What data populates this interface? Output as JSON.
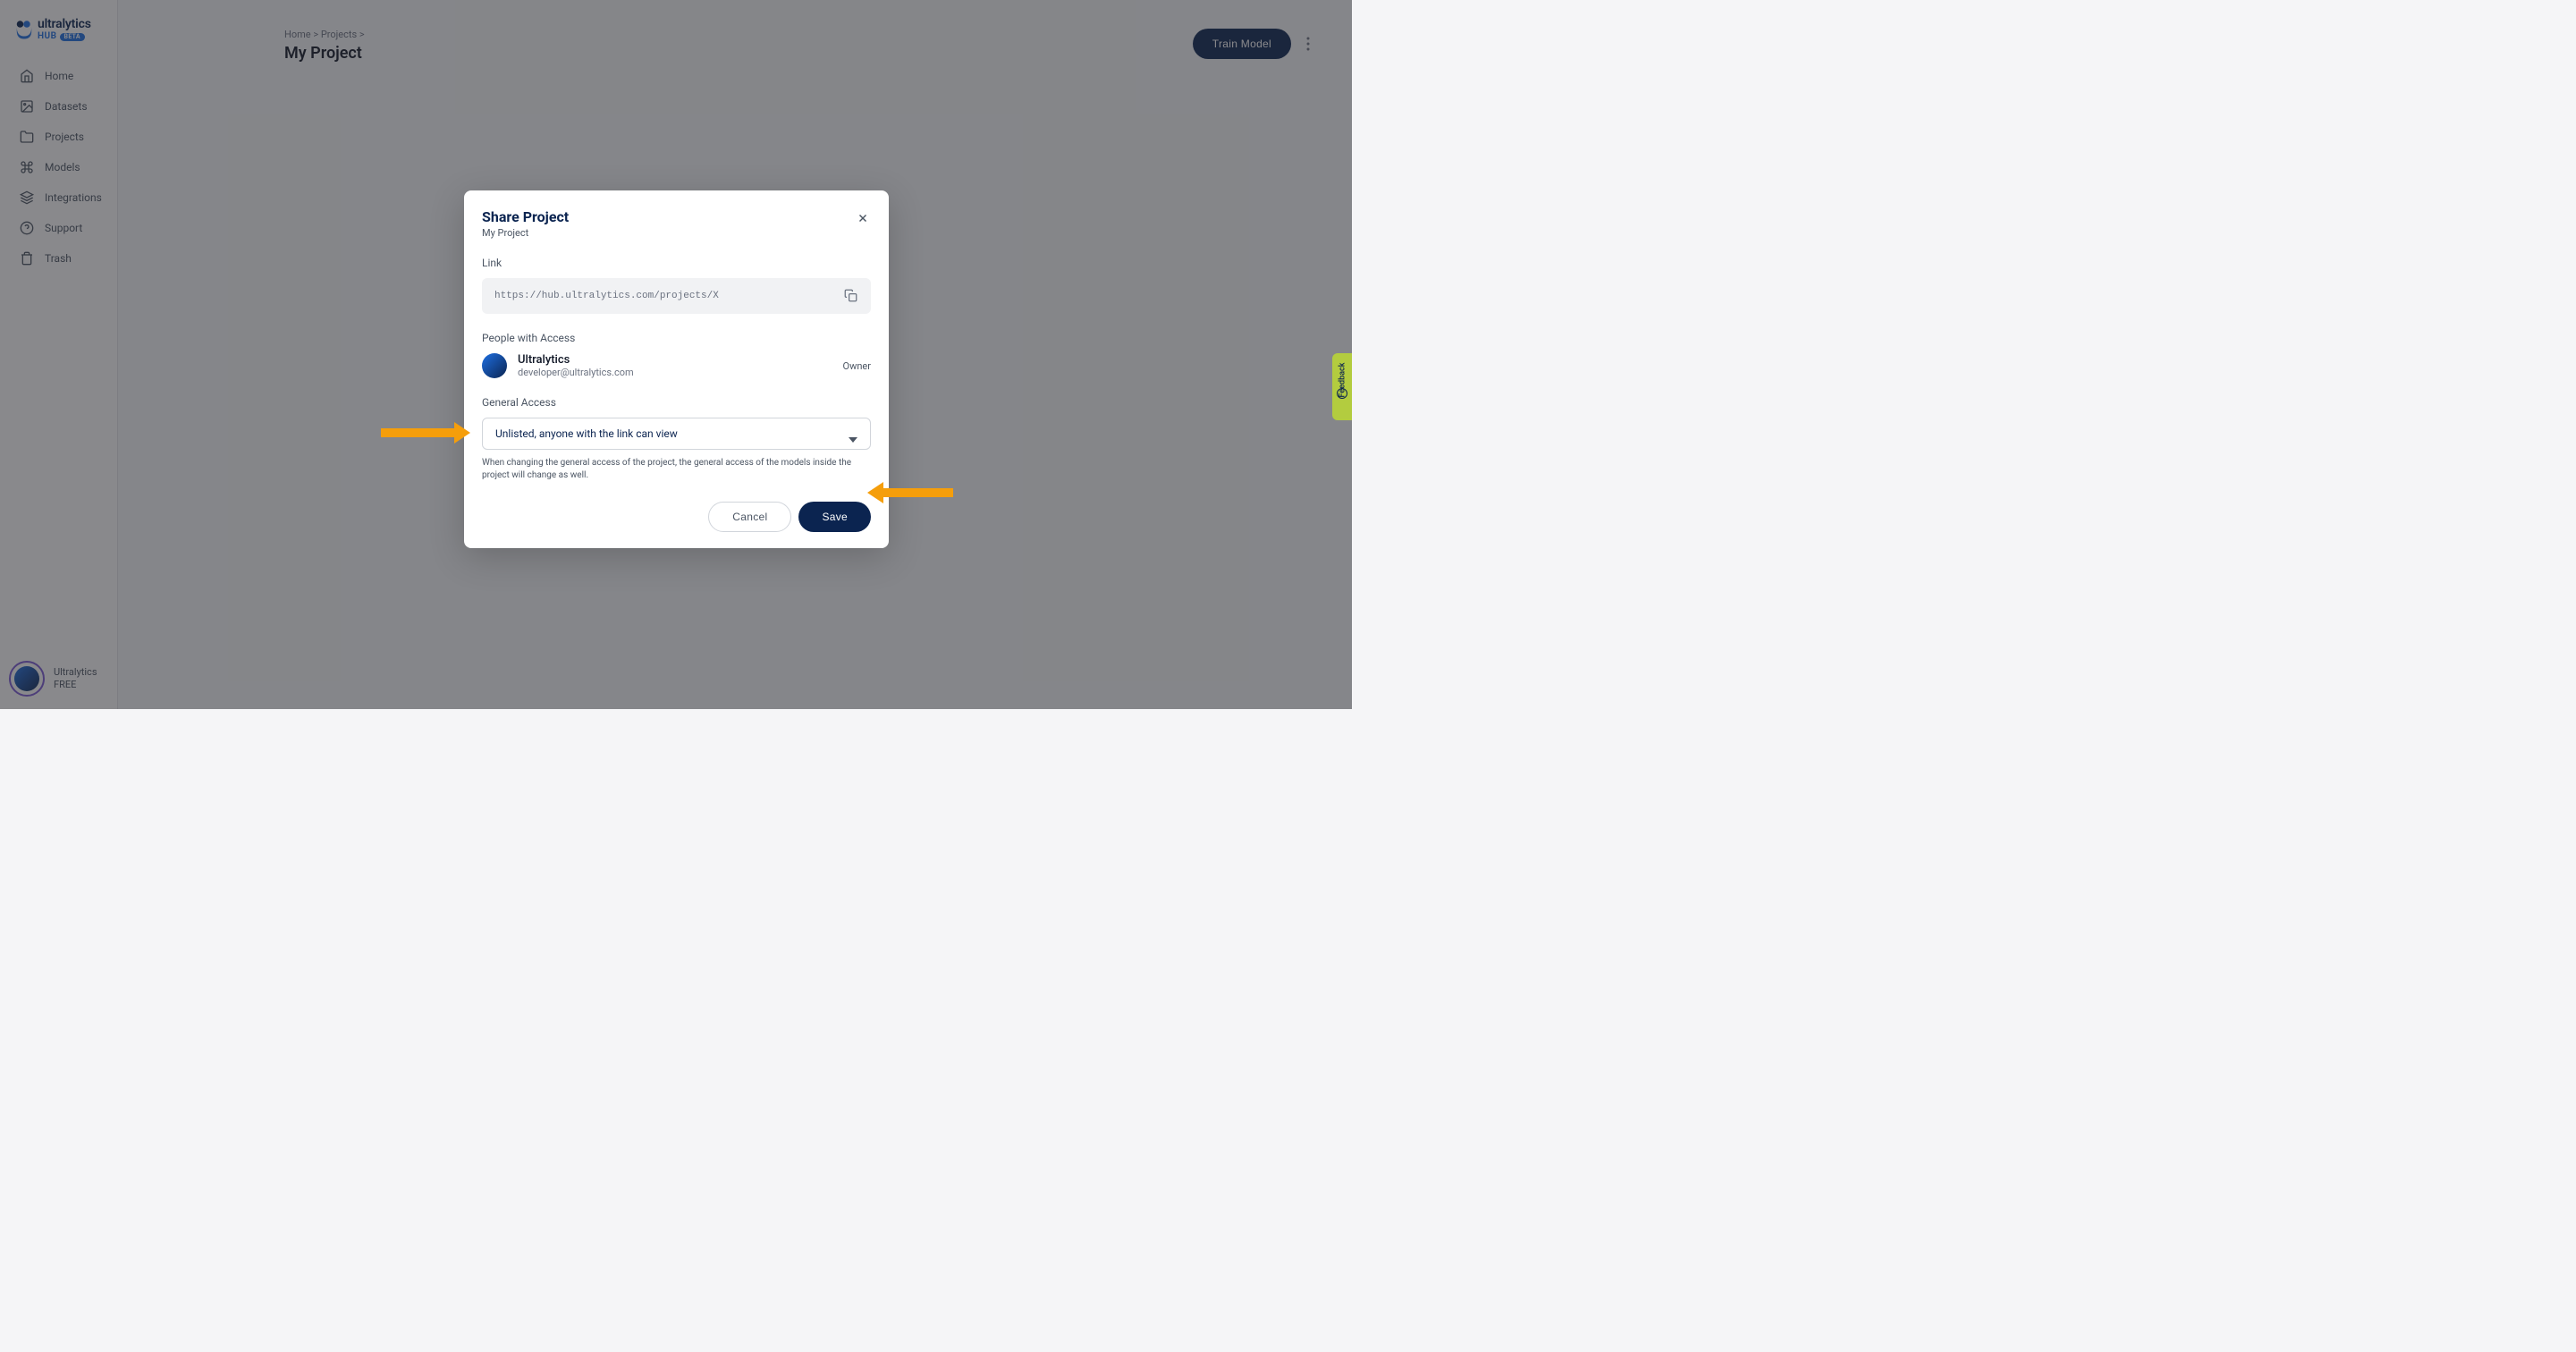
{
  "brand": {
    "name": "ultralytics",
    "hub": "HUB",
    "badge": "BETA"
  },
  "nav": {
    "items": [
      {
        "label": "Home",
        "icon": "home"
      },
      {
        "label": "Datasets",
        "icon": "image"
      },
      {
        "label": "Projects",
        "icon": "folder"
      },
      {
        "label": "Models",
        "icon": "command"
      },
      {
        "label": "Integrations",
        "icon": "layers"
      },
      {
        "label": "Support",
        "icon": "question"
      },
      {
        "label": "Trash",
        "icon": "trash"
      }
    ]
  },
  "footer": {
    "name": "Ultralytics",
    "plan": "FREE"
  },
  "breadcrumb": {
    "home": "Home",
    "projects": "Projects",
    "sep": ">"
  },
  "page": {
    "title": "My Project"
  },
  "header_actions": {
    "train": "Train Model"
  },
  "modal": {
    "title": "Share Project",
    "subtitle": "My Project",
    "link_label": "Link",
    "link_url": "https://hub.ultralytics.com/projects/X",
    "people_label": "People with Access",
    "person": {
      "name": "Ultralytics",
      "email": "developer@ultralytics.com",
      "role": "Owner"
    },
    "general_label": "General Access",
    "select_value": "Unlisted, anyone with the link can view",
    "help": "When changing the general access of the project, the general access of the models inside the project will change as well.",
    "cancel": "Cancel",
    "save": "Save"
  },
  "feedback": {
    "label": "Feedback"
  }
}
